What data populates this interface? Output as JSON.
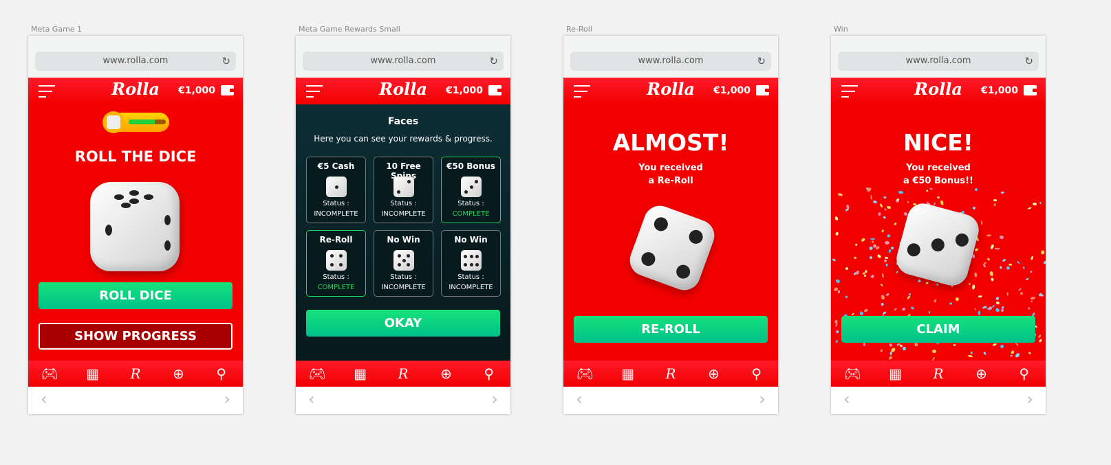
{
  "browser": {
    "url": "www.rolla.com"
  },
  "header": {
    "logo": "Rolla",
    "balance": "€1,000"
  },
  "nav": {
    "icons": [
      "gamepad-icon",
      "checkered-flag-icon",
      "rolla-r-icon",
      "target-icon",
      "search-icon"
    ],
    "r": "R"
  },
  "screens": [
    {
      "label": "Meta Game 1",
      "title": "ROLL THE DICE",
      "progress": 0.7,
      "primary": "ROLL DICE",
      "secondary": "SHOW PROGRESS"
    },
    {
      "label": "Meta Game Rewards Small",
      "title": "Faces",
      "subtitle": "Here you can see your rewards & progress.",
      "status_label": "Status :",
      "cards": [
        {
          "name": "€5 Cash",
          "pips": 1,
          "status": "INCOMPLETE"
        },
        {
          "name": "10 Free Spins",
          "pips": 2,
          "status": "INCOMPLETE"
        },
        {
          "name": "€50 Bonus",
          "pips": 3,
          "status": "COMPLETE"
        },
        {
          "name": "Re-Roll",
          "pips": 4,
          "status": "COMPLETE"
        },
        {
          "name": "No Win",
          "pips": 5,
          "status": "INCOMPLETE"
        },
        {
          "name": "No Win",
          "pips": 6,
          "status": "INCOMPLETE"
        }
      ],
      "button": "OKAY"
    },
    {
      "label": "Re-Roll",
      "title": "ALMOST!",
      "line1": "You received",
      "line2": "a Re-Roll",
      "button": "RE-ROLL"
    },
    {
      "label": "Win",
      "title": "NICE!",
      "line1": "You received",
      "line2": "a €50 Bonus!!",
      "button": "CLAIM"
    }
  ],
  "colors": {
    "red": "#f20000",
    "green": "#17e27a",
    "complete": "#1fd65a",
    "dark": "#0d3038"
  }
}
